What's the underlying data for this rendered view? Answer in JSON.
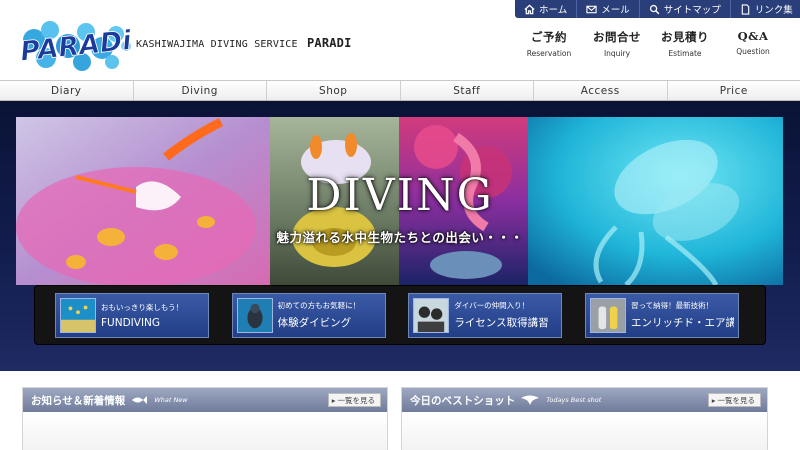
{
  "utility_nav": [
    {
      "label": "ホーム",
      "icon": "home-icon"
    },
    {
      "label": "メール",
      "icon": "mail-icon"
    },
    {
      "label": "サイトマップ",
      "icon": "search-icon"
    },
    {
      "label": "リンク集",
      "icon": "document-icon"
    }
  ],
  "brand": {
    "logo_text": "PARADi",
    "tagline": "KASHIWAJIMA DIVING SERVICE",
    "name": "PARADI"
  },
  "contact_nav": [
    {
      "jp": "ご予約",
      "en": "Reservation"
    },
    {
      "jp": "お問合せ",
      "en": "Inquiry"
    },
    {
      "jp": "お見積り",
      "en": "Estimate"
    },
    {
      "jp": "Q&A",
      "en": "Question"
    }
  ],
  "main_nav": [
    "Diary",
    "Diving",
    "Shop",
    "Staff",
    "Access",
    "Price"
  ],
  "hero": {
    "headline": "DIVING",
    "subheadline": "魅力溢れる水中生物たちとの出会い・・・"
  },
  "courses": [
    {
      "small": "おもいっきり楽しもう！",
      "big": "FUNDIVING"
    },
    {
      "small": "初めての方もお気軽に！",
      "big": "体験ダイビング"
    },
    {
      "small": "ダイバーの仲間入り！",
      "big": "ライセンス取得講習"
    },
    {
      "small": "習って納得！最新技術！",
      "big": "エンリッチド・エア講習"
    }
  ],
  "panels": [
    {
      "title": "お知らせ＆新着情報",
      "sub": "What New",
      "more": "一覧を見る"
    },
    {
      "title": "今日のベストショット",
      "sub": "Todays Best shot",
      "more": "一覧を見る"
    }
  ],
  "colors": {
    "utility_bar": "#2a3e7a",
    "hero_bg": "#0e1640",
    "course_button": "#2b4a98",
    "panel_header": "#8691ad"
  }
}
